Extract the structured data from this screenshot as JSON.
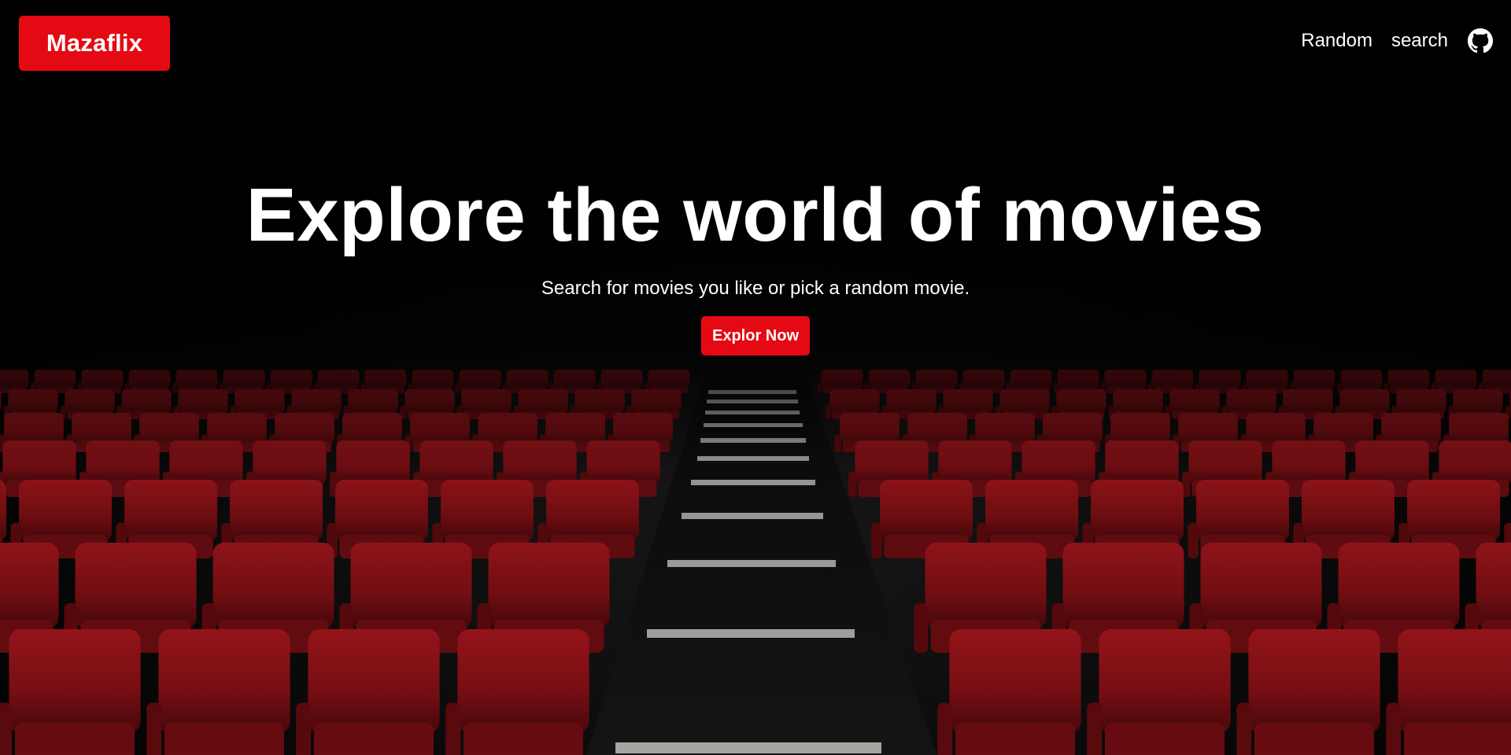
{
  "header": {
    "logo_text": "Mazaflix",
    "nav": {
      "random_label": "Random",
      "search_label": "search",
      "github_icon": "github-icon"
    }
  },
  "hero": {
    "title": "Explore the world of movies",
    "subtitle": "Search for movies you like or pick a random movie.",
    "cta_label": "Explor Now",
    "background_image": "cinema-red-seats"
  },
  "colors": {
    "brand": "#e50914",
    "background": "#050505",
    "text": "#ffffff",
    "seat": "#8e1218"
  }
}
